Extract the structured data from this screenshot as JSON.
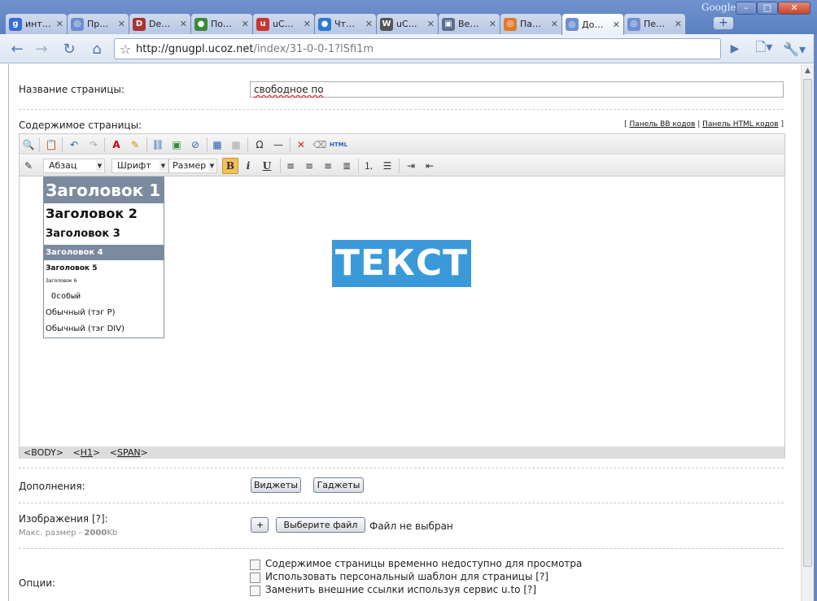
{
  "browser": {
    "tabs": [
      {
        "label": "инт…",
        "icon": "google-icon",
        "color": "#3b6bd6",
        "glyph": "g"
      },
      {
        "label": "Пр…",
        "icon": "ucoz-icon",
        "color": "#6d8fd1",
        "glyph": "◎"
      },
      {
        "label": "De…",
        "icon": "deviantart-icon",
        "color": "#a33",
        "glyph": "D"
      },
      {
        "label": "По…",
        "icon": "globe-icon",
        "color": "#3a8b3a",
        "glyph": "●"
      },
      {
        "label": "uC…",
        "icon": "ucoz-red-icon",
        "color": "#c33",
        "glyph": "u"
      },
      {
        "label": "Чт…",
        "icon": "chrome-icon",
        "color": "#2c78d4",
        "glyph": "●"
      },
      {
        "label": "uC…",
        "icon": "wikipedia-icon",
        "color": "#555",
        "glyph": "W"
      },
      {
        "label": "Ве…",
        "icon": "photo-icon",
        "color": "#5a6f8c",
        "glyph": "▣"
      },
      {
        "label": "Па…",
        "icon": "ucoz-orange-icon",
        "color": "#e07a2e",
        "glyph": "◎"
      },
      {
        "label": "До…",
        "icon": "ucoz-blue-icon",
        "color": "#6d8fd1",
        "glyph": "◎",
        "active": true
      },
      {
        "label": "Пе…",
        "icon": "ucoz-blue-icon",
        "color": "#6d8fd1",
        "glyph": "◎"
      }
    ],
    "google_label": "Google",
    "url_host": "http://gnugpl.ucoz.net",
    "url_path": "/index/31-0-0-1?lSfi1m"
  },
  "form": {
    "page_name_label": "Название страницы:",
    "page_name_value": "свободное по",
    "content_label": "Содержимое страницы:",
    "panel_bb": "Панель BB кодов",
    "panel_html": "Панель HTML кодов",
    "paragraph_select": "Абзац",
    "font_select": "Шрифт",
    "size_select": "Размер",
    "dropdown_items": [
      "Заголовок 1",
      "Заголовок 2",
      "Заголовок 3",
      "Заголовок 4",
      "Заголовок 5",
      "Заголовок 6",
      "Особый",
      "Обычный (тэг P)",
      "Обычный (тэг DIV)"
    ],
    "editor_text": "ТЕКСТ",
    "path_body": "<BODY>",
    "path_h1": "H1",
    "path_span": "SPAN",
    "addons_label": "Дополнения:",
    "widgets_button": "Виджеты",
    "gadgets_button": "Гаджеты",
    "images_label": "Изображения [?]:",
    "max_size_prefix": "Макс. размер - ",
    "max_size_value": "2000",
    "max_size_unit": "Kb",
    "add_button": "+",
    "choose_file_button": "Выберите файл",
    "no_file": "Файл не выбран",
    "options_label": "Опции:",
    "options": [
      "Содержимое страницы временно недоступно для просмотра",
      "Использовать персональный шаблон для страницы [?]",
      "Заменить внешние ссылки используя сервис u.to [?]"
    ]
  }
}
